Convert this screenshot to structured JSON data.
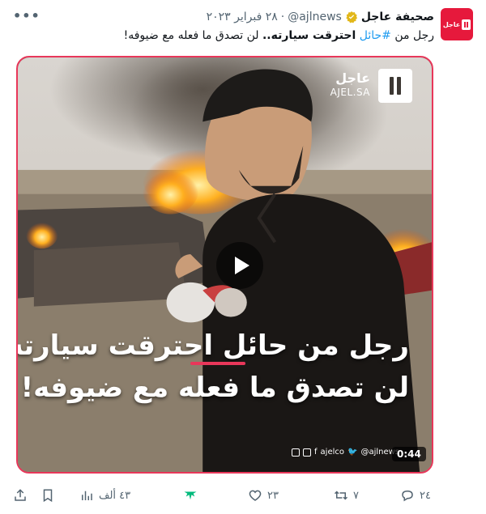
{
  "header": {
    "display_name": "صحيفة عاجل",
    "handle": "@ajlnews",
    "separator": "·",
    "date": "٢٨ فبراير ٢٠٢٣",
    "more_label": "•••"
  },
  "avatar": {
    "text": "عاجل",
    "color": "#e6193c"
  },
  "tweet_text": {
    "prefix": "رجل من ",
    "hashtag": "#حائل",
    "bold": "احترقت سيارته..",
    "suffix": " لن تصدق ما فعله مع ضيوفه!"
  },
  "video": {
    "logo_arabic": "عاجل",
    "logo_latin": "AJEL.SA",
    "caption_line1": "رجل من حائل احترقت سيارته",
    "caption_line2": "لن تصدق ما فعله مع ضيوفه!",
    "social_handle1": "ajelco",
    "social_handle2": "@ajlnews",
    "duration": "0:44",
    "border_color": "#e8375a"
  },
  "actions": {
    "reply_count": "٢٤",
    "retweet_count": "٧",
    "like_count": "٢٣",
    "views_count": "٤٣ ألف"
  }
}
